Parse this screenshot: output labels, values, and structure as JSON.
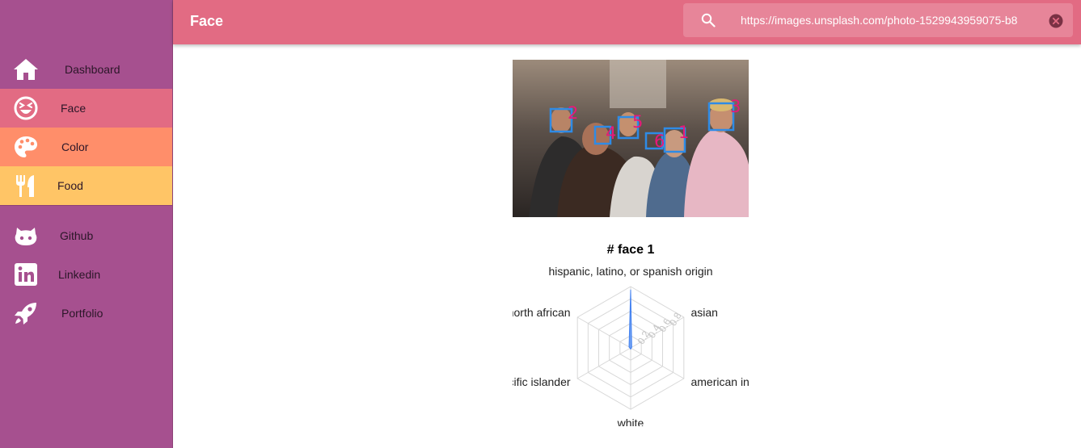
{
  "sidebar": {
    "items": [
      {
        "label": "Dashboard",
        "icon": "home-icon"
      },
      {
        "label": "Face",
        "icon": "laughing-face-icon",
        "bg": "#e26b83",
        "active": true
      },
      {
        "label": "Color",
        "icon": "palette-icon",
        "bg": "#ff8e6a"
      },
      {
        "label": "Food",
        "icon": "utensils-icon",
        "bg": "#ffc566"
      },
      {
        "label": "Github",
        "icon": "github-icon"
      },
      {
        "label": "Linkedin",
        "icon": "linkedin-icon"
      },
      {
        "label": "Portfolio",
        "icon": "rocket-icon"
      }
    ]
  },
  "header": {
    "title": "Face",
    "search": {
      "value": "https://images.unsplash.com/photo-1529943959075-b8",
      "search_icon": "search-icon",
      "clear_icon": "clear-icon"
    }
  },
  "colors": {
    "sidebar": "#a6508f",
    "header": "#e26b83",
    "face_box": "#2e8be6",
    "face_number": "#e6197a",
    "radar_fill": "#5b94f5"
  },
  "main": {
    "photo": {
      "faces": [
        {
          "number": "1"
        },
        {
          "number": "2"
        },
        {
          "number": "3"
        },
        {
          "number": "4"
        },
        {
          "number": "5"
        },
        {
          "number": "6"
        }
      ]
    },
    "chart_title": "# face 1"
  },
  "chart_data": {
    "type": "radar",
    "title": "# face 1",
    "categories": [
      "hispanic, latino, or spanish origin",
      "asian",
      "american indian",
      "white",
      "pacific islander",
      "north african"
    ],
    "values": [
      0.95,
      0.02,
      0.01,
      0.02,
      0.01,
      0.03
    ],
    "ticks": [
      "0.2",
      "0.4",
      "0.6",
      "0.8"
    ],
    "rmax": 1.0
  }
}
